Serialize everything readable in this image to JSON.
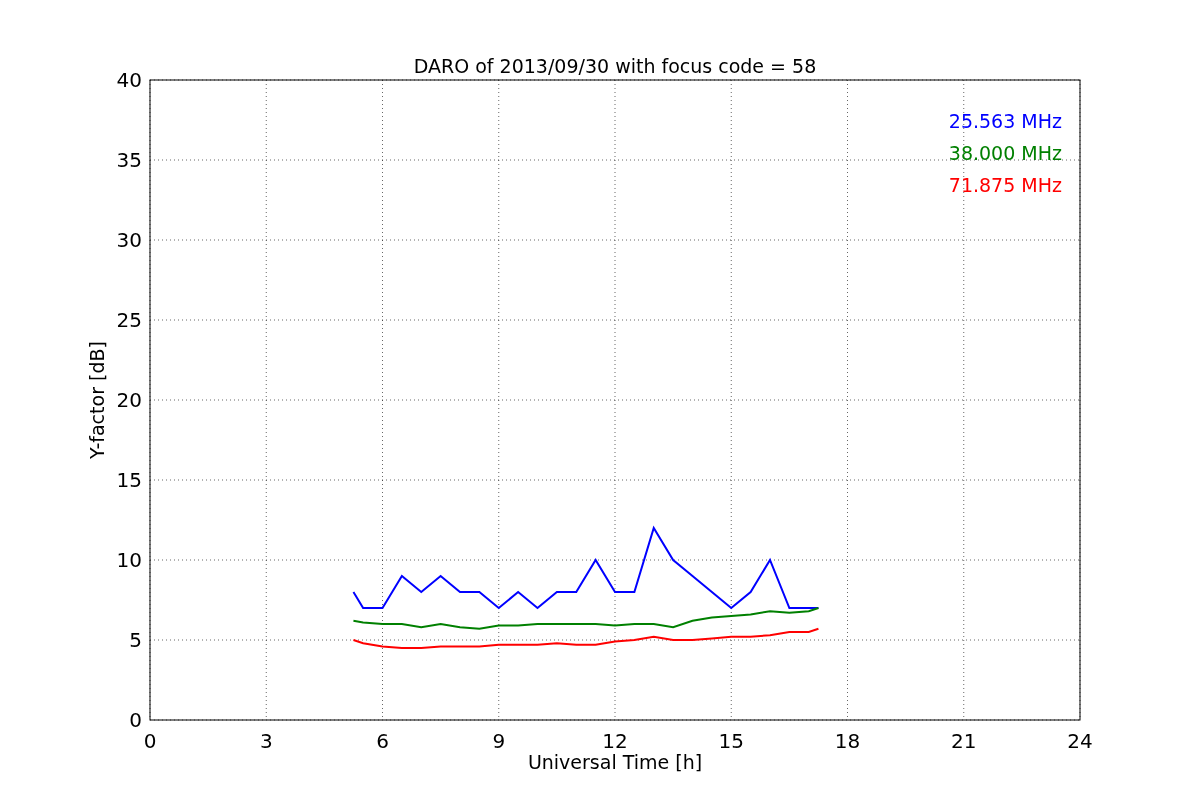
{
  "figure": {
    "chart_data": {
      "type": "line",
      "title": "DARO of 2013/09/30 with focus code = 58",
      "xlabel": "Universal Time [h]",
      "ylabel": "Y-factor [dB]",
      "x": [
        5.25,
        5.5,
        6,
        6.5,
        7,
        7.5,
        8,
        8.5,
        9,
        9.5,
        10,
        10.5,
        11,
        11.5,
        12,
        12.5,
        13,
        13.5,
        14,
        14.5,
        15,
        15.5,
        16,
        16.5,
        17,
        17.25
      ],
      "series": [
        {
          "name": "25.563 MHz",
          "color": "#0000ff",
          "values": [
            8,
            7,
            7,
            9,
            8,
            9,
            8,
            8,
            7,
            8,
            7,
            8,
            8,
            10,
            8,
            8,
            12,
            10,
            9,
            8,
            7,
            8,
            10,
            7,
            7,
            7
          ]
        },
        {
          "name": "38.000 MHz",
          "color": "#008000",
          "values": [
            6.2,
            6.1,
            6,
            6,
            5.8,
            6,
            5.8,
            5.7,
            5.9,
            5.9,
            6,
            6,
            6,
            6,
            5.9,
            6,
            6,
            5.8,
            6.2,
            6.4,
            6.5,
            6.6,
            6.8,
            6.7,
            6.8,
            7
          ]
        },
        {
          "name": "71.875 MHz",
          "color": "#ff0000",
          "values": [
            5,
            4.8,
            4.6,
            4.5,
            4.5,
            4.6,
            4.6,
            4.6,
            4.7,
            4.7,
            4.7,
            4.8,
            4.7,
            4.7,
            4.9,
            5,
            5.2,
            5,
            5,
            5.1,
            5.2,
            5.2,
            5.3,
            5.5,
            5.5,
            5.7
          ]
        }
      ],
      "grid": true,
      "xlim": [
        0,
        24
      ],
      "ylim": [
        0,
        40
      ],
      "xticks": [
        0,
        3,
        6,
        9,
        12,
        15,
        18,
        21,
        24
      ],
      "yticks": [
        0,
        5,
        10,
        15,
        20,
        25,
        30,
        35,
        40
      ]
    }
  }
}
